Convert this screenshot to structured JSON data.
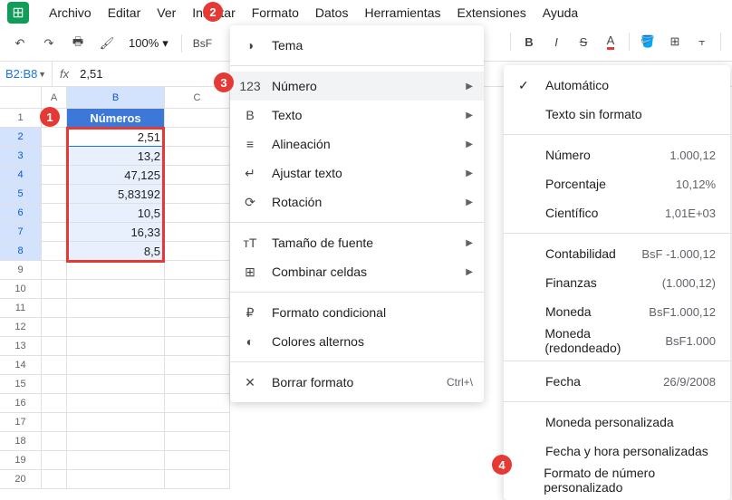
{
  "menubar": [
    "Archivo",
    "Editar",
    "Ver",
    "Insertar",
    "Formato",
    "Datos",
    "Herramientas",
    "Extensiones",
    "Ayuda"
  ],
  "toolbar": {
    "zoom": "100%",
    "currency": "BsF"
  },
  "namebox": "B2:B8",
  "formula": "2,51",
  "columns": [
    "A",
    "B",
    "C"
  ],
  "header_cell": "Números",
  "data_values": [
    "2,51",
    "13,2",
    "47,125",
    "5,83192",
    "10,5",
    "16,33",
    "8,5"
  ],
  "row_count": 20,
  "format_menu": {
    "items": [
      {
        "icon": "◑",
        "label": "Tema"
      },
      null,
      {
        "icon": "123",
        "label": "Número",
        "arrow": true,
        "hover": true
      },
      {
        "icon": "B",
        "label": "Texto",
        "arrow": true
      },
      {
        "icon": "≡",
        "label": "Alineación",
        "arrow": true
      },
      {
        "icon": "↵",
        "label": "Ajustar texto",
        "arrow": true
      },
      {
        "icon": "⟳",
        "label": "Rotación",
        "arrow": true
      },
      null,
      {
        "icon": "тT",
        "label": "Tamaño de fuente",
        "arrow": true
      },
      {
        "icon": "⊞",
        "label": "Combinar celdas",
        "arrow": true
      },
      null,
      {
        "icon": "₽",
        "label": "Formato condicional"
      },
      {
        "icon": "◐",
        "label": "Colores alternos"
      },
      null,
      {
        "icon": "✕",
        "label": "Borrar formato",
        "shortcut": "Ctrl+\\"
      }
    ]
  },
  "number_submenu": {
    "items": [
      {
        "check": true,
        "label": "Automático"
      },
      {
        "label": "Texto sin formato"
      },
      null,
      {
        "label": "Número",
        "example": "1.000,12"
      },
      {
        "label": "Porcentaje",
        "example": "10,12%"
      },
      {
        "label": "Científico",
        "example": "1,01E+03"
      },
      null,
      {
        "label": "Contabilidad",
        "example": "BsF -1.000,12"
      },
      {
        "label": "Finanzas",
        "example": "(1.000,12)"
      },
      {
        "label": "Moneda",
        "example": "BsF1.000,12"
      },
      {
        "label": "Moneda (redondeado)",
        "example": "BsF1.000"
      },
      null,
      {
        "label": "Fecha",
        "example": "26/9/2008"
      },
      null,
      {
        "label": "Moneda personalizada"
      },
      {
        "label": "Fecha y hora personalizadas"
      },
      {
        "label": "Formato de número personalizado"
      }
    ]
  },
  "badges": [
    "1",
    "2",
    "3",
    "4"
  ]
}
